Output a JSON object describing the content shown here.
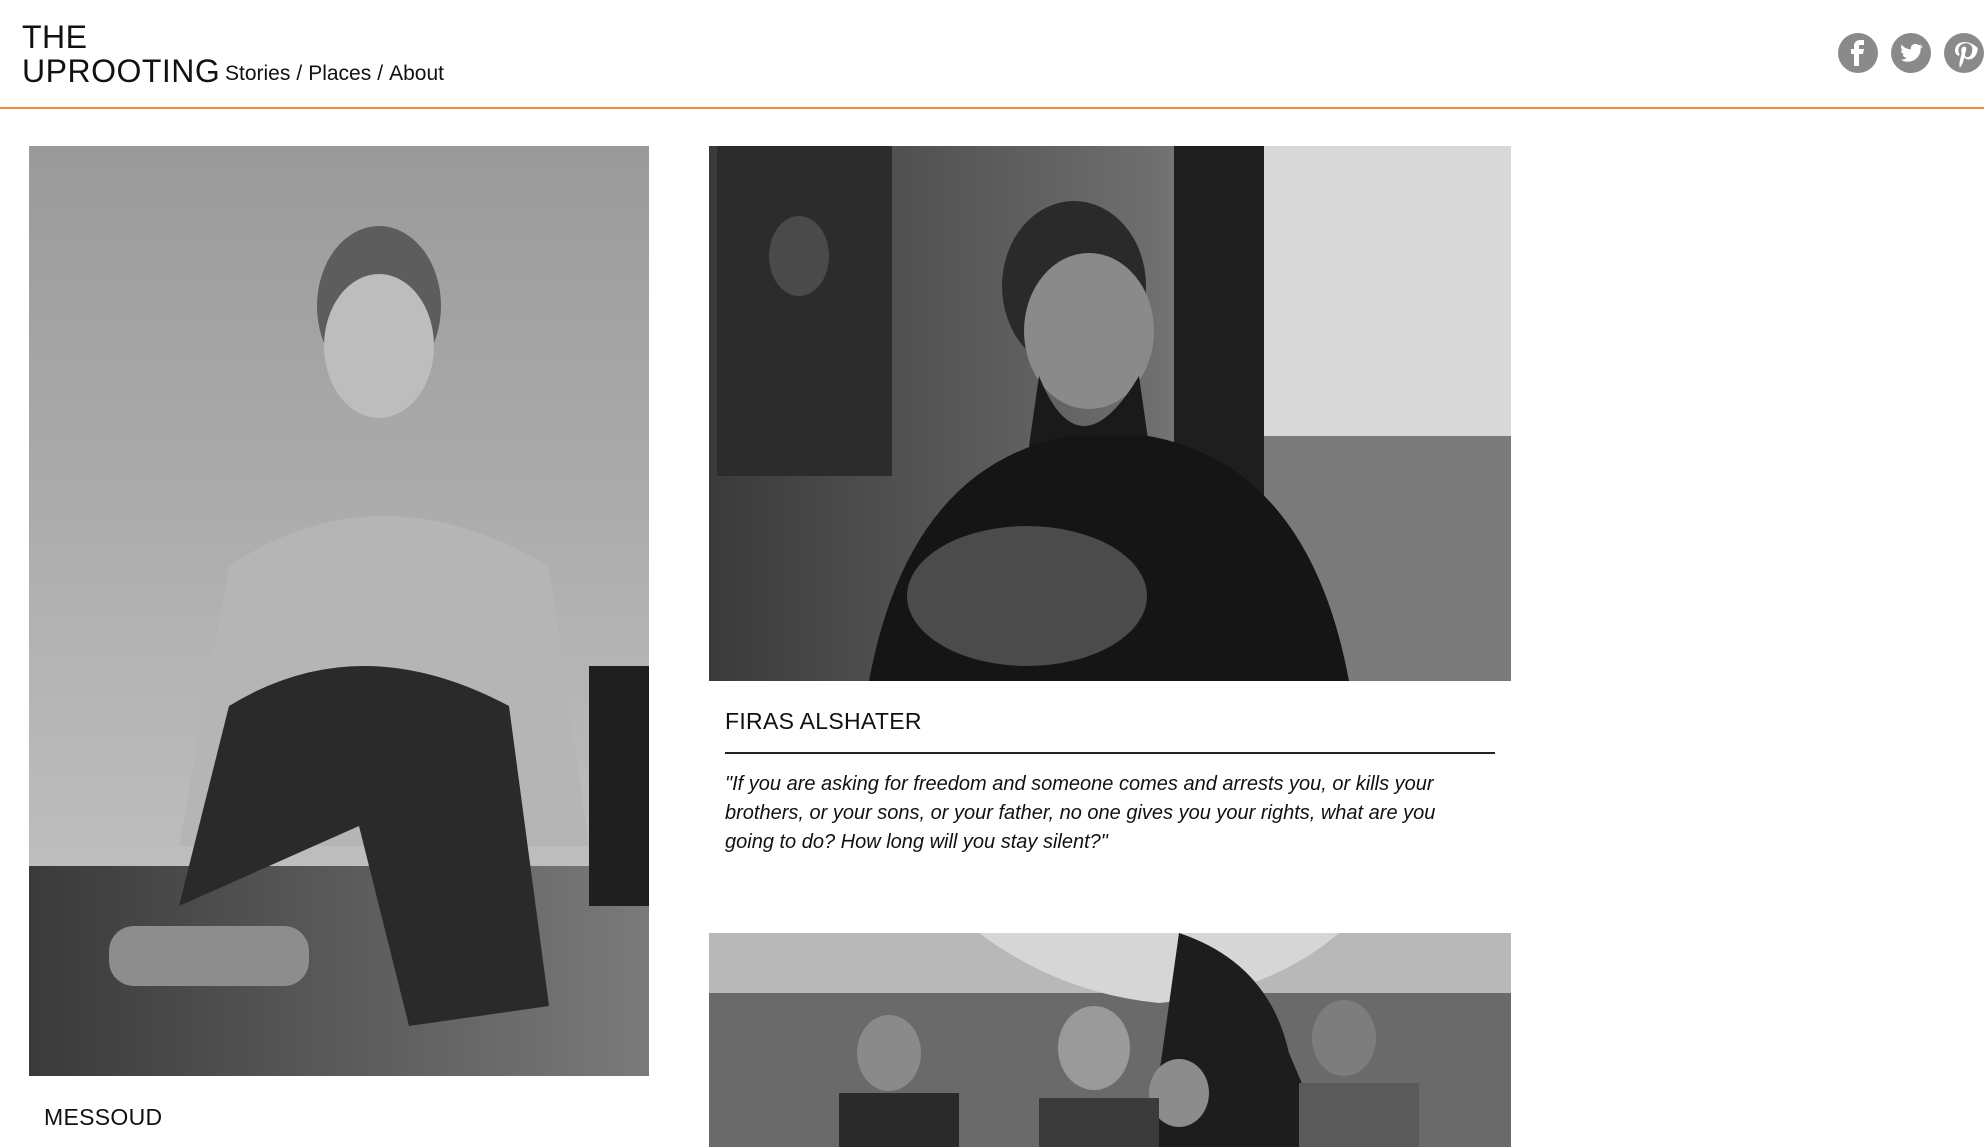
{
  "header": {
    "title_line1": "THE",
    "title_line2": "UPROOTING",
    "nav": {
      "stories": "Stories",
      "places": "Places",
      "about": "About",
      "separator": "/"
    },
    "social": {
      "facebook_glyph": "f",
      "twitter_glyph": "t",
      "pinterest_glyph": "p"
    },
    "accent_color": "#f08a3c"
  },
  "stories": [
    {
      "name": "MESSOUD"
    },
    {
      "name": "FIRAS ALSHATER",
      "quote": "\"If you are asking for freedom and someone comes and arrests you, or kills your brothers, or your sons, or your father, no one gives you your rights, what are you going to do? How long will you stay silent?\""
    }
  ]
}
